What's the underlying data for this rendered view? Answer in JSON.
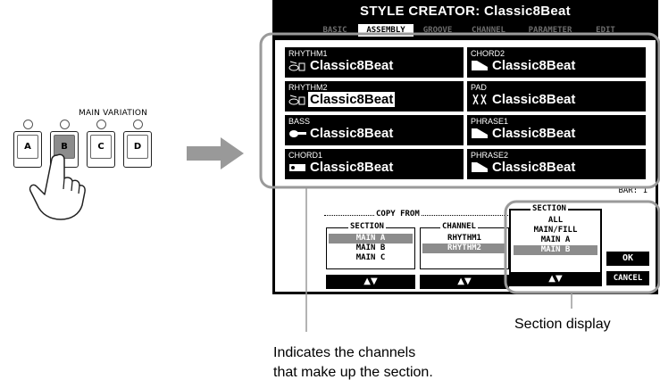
{
  "main_variation": {
    "label": "MAIN VARIATION",
    "buttons": [
      "A",
      "B",
      "C",
      "D"
    ],
    "pressed": "B"
  },
  "screen": {
    "title": "STYLE CREATOR: Classic8Beat",
    "tabs": [
      "BASIC",
      "ASSEMBLY",
      "GROOVE",
      "CHANNEL",
      "PARAMETER",
      "EDIT"
    ],
    "active_tab": "ASSEMBLY",
    "channels": [
      {
        "name": "RHYTHM1",
        "style": "Classic8Beat",
        "icon": "drum-kit-icon"
      },
      {
        "name": "CHORD2",
        "style": "Classic8Beat",
        "icon": "keyboard-icon"
      },
      {
        "name": "RHYTHM2",
        "style": "Classic8Beat",
        "icon": "drum-kit-icon",
        "selected": true
      },
      {
        "name": "PAD",
        "style": "Classic8Beat",
        "icon": "strings-icon"
      },
      {
        "name": "BASS",
        "style": "Classic8Beat",
        "icon": "bass-guitar-icon"
      },
      {
        "name": "PHRASE1",
        "style": "Classic8Beat",
        "icon": "keyboard-icon"
      },
      {
        "name": "CHORD1",
        "style": "Classic8Beat",
        "icon": "guitar-icon"
      },
      {
        "name": "PHRASE2",
        "style": "Classic8Beat",
        "icon": "keyboard-icon"
      }
    ],
    "bar_label": "BAR:",
    "bar_value": "1",
    "copy_from": {
      "label": "COPY FROM",
      "section": {
        "label": "SECTION",
        "items": [
          "MAIN A",
          "MAIN B",
          "MAIN C"
        ],
        "selected": "MAIN A"
      },
      "channel": {
        "label": "CHANNEL",
        "items": [
          "RHYTHM1",
          "RHYTHM2"
        ],
        "selected": "RHYTHM2"
      },
      "arrows": "▲▼"
    },
    "section_display": {
      "label": "SECTION",
      "items": [
        "ALL",
        "MAIN/FILL",
        "MAIN A",
        "MAIN B"
      ],
      "selected": "MAIN B",
      "arrows": "▲▼"
    },
    "ok_label": "OK",
    "cancel_label": "CANCEL"
  },
  "callouts": {
    "section_display": "Section display",
    "channels_line1": "Indicates the channels",
    "channels_line2": "that make up the section."
  }
}
